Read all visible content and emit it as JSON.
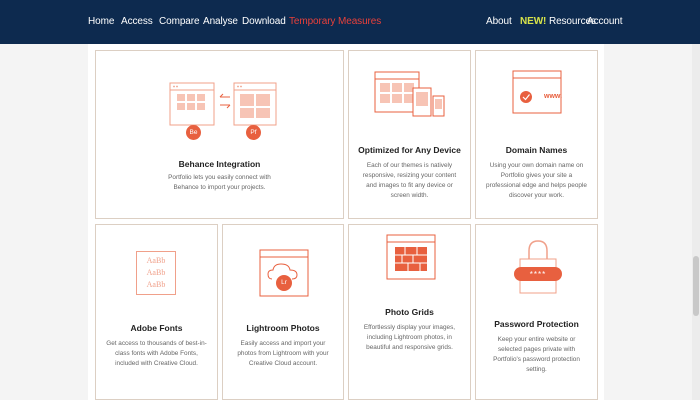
{
  "nav": {
    "left": [
      "Home",
      "Access",
      "Compare",
      "Analyse",
      "Download",
      "Temporary Measures"
    ],
    "active": "Temporary Measures",
    "about": "About",
    "new_badge": "NEW!",
    "resources": "Resources",
    "account": "Account"
  },
  "colors": {
    "nav_bg": "#0d2a4f",
    "accent": "#e8403a",
    "new_badge": "#d7e34a",
    "illustration": "#e8603f"
  },
  "cards": {
    "behance": {
      "title": "Behance Integration",
      "desc": "Portfolio lets you easily connect with Behance to import your projects.",
      "badge_be": "Be",
      "badge_pf": "Pf"
    },
    "optimized": {
      "title": "Optimized for Any Device",
      "desc": "Each of our themes is natively responsive, resizing your content and images to fit any device or screen width."
    },
    "domain": {
      "title": "Domain Names",
      "desc": "Using your own domain name on Portfolio gives your site a professional edge and helps people discover your work.",
      "www": "www."
    },
    "fonts": {
      "title": "Adobe Fonts",
      "desc": "Get access to thousands of best-in-class fonts with Adobe Fonts, included with Creative Cloud.",
      "sample": "AaBb"
    },
    "lightroom": {
      "title": "Lightroom Photos",
      "desc": "Easily access and import your photos from Lightroom with your Creative Cloud account.",
      "badge_lr": "Lr"
    },
    "grids": {
      "title": "Photo Grids",
      "desc": "Effortlessly display your images, including Lightroom photos, in beautiful and responsive grids."
    },
    "password": {
      "title": "Password Protection",
      "desc": "Keep your entire website or selected pages private with Portfolio's password protection setting.",
      "mask": "****"
    }
  }
}
